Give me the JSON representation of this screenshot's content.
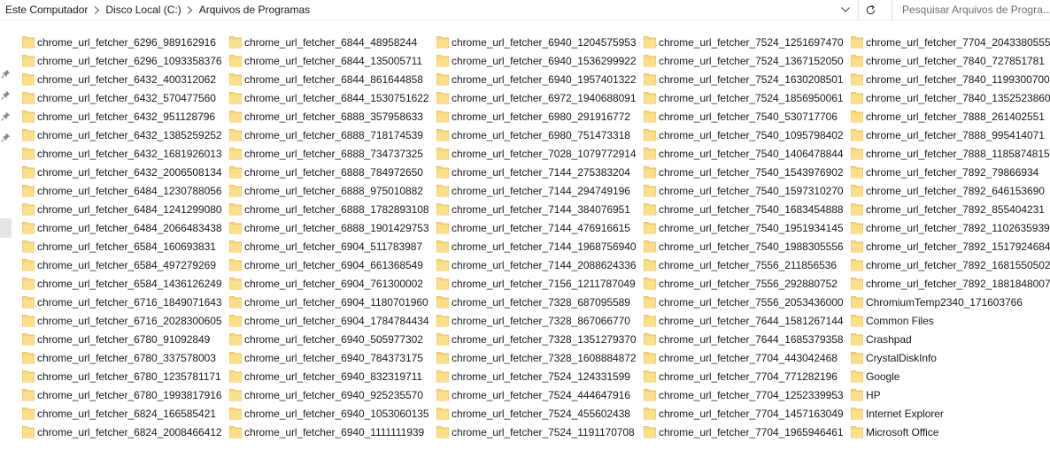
{
  "breadcrumb": {
    "items": [
      "Este Computador",
      "Disco Local (C:)",
      "Arquivos de Programas"
    ]
  },
  "search": {
    "placeholder": "Pesquisar Arquivos de Progra..."
  },
  "colors": {
    "folder_fill": "#f8d775",
    "folder_edge": "#e3b444",
    "hover": "#e5f3ff"
  },
  "icons": {
    "separator": "chevron-right-icon",
    "dropdown": "chevron-down-icon",
    "refresh": "refresh-icon",
    "pin": "pin-icon",
    "folder": "folder-icon"
  },
  "folders": {
    "columns": [
      [
        "chrome_url_fetcher_6296_989162916",
        "chrome_url_fetcher_6296_1093358376",
        "chrome_url_fetcher_6432_400312062",
        "chrome_url_fetcher_6432_570477560",
        "chrome_url_fetcher_6432_951128796",
        "chrome_url_fetcher_6432_1385259252",
        "chrome_url_fetcher_6432_1681926013",
        "chrome_url_fetcher_6432_2006508134",
        "chrome_url_fetcher_6484_1230788056",
        "chrome_url_fetcher_6484_1241299080",
        "chrome_url_fetcher_6484_2066483438",
        "chrome_url_fetcher_6584_160693831",
        "chrome_url_fetcher_6584_497279269",
        "chrome_url_fetcher_6584_1436126249",
        "chrome_url_fetcher_6716_1849071643",
        "chrome_url_fetcher_6716_2028300605",
        "chrome_url_fetcher_6780_91092849",
        "chrome_url_fetcher_6780_337578003",
        "chrome_url_fetcher_6780_1235781171",
        "chrome_url_fetcher_6780_1993817916",
        "chrome_url_fetcher_6824_166585421",
        "chrome_url_fetcher_6824_2008466412"
      ],
      [
        "chrome_url_fetcher_6844_48958244",
        "chrome_url_fetcher_6844_135005711",
        "chrome_url_fetcher_6844_861644858",
        "chrome_url_fetcher_6844_1530751622",
        "chrome_url_fetcher_6888_357958633",
        "chrome_url_fetcher_6888_718174539",
        "chrome_url_fetcher_6888_734737325",
        "chrome_url_fetcher_6888_784972650",
        "chrome_url_fetcher_6888_975010882",
        "chrome_url_fetcher_6888_1782893108",
        "chrome_url_fetcher_6888_1901429753",
        "chrome_url_fetcher_6904_511783987",
        "chrome_url_fetcher_6904_661368549",
        "chrome_url_fetcher_6904_761300002",
        "chrome_url_fetcher_6904_1180701960",
        "chrome_url_fetcher_6904_1784784434",
        "chrome_url_fetcher_6940_505977302",
        "chrome_url_fetcher_6940_784373175",
        "chrome_url_fetcher_6940_832319711",
        "chrome_url_fetcher_6940_925235570",
        "chrome_url_fetcher_6940_1053060135",
        "chrome_url_fetcher_6940_1111111939"
      ],
      [
        "chrome_url_fetcher_6940_1204575953",
        "chrome_url_fetcher_6940_1536299922",
        "chrome_url_fetcher_6940_1957401322",
        "chrome_url_fetcher_6972_1940688091",
        "chrome_url_fetcher_6980_291916772",
        "chrome_url_fetcher_6980_751473318",
        "chrome_url_fetcher_7028_1079772914",
        "chrome_url_fetcher_7144_275383204",
        "chrome_url_fetcher_7144_294749196",
        "chrome_url_fetcher_7144_384076951",
        "chrome_url_fetcher_7144_476916615",
        "chrome_url_fetcher_7144_1968756940",
        "chrome_url_fetcher_7144_2088624336",
        "chrome_url_fetcher_7156_1211787049",
        "chrome_url_fetcher_7328_687095589",
        "chrome_url_fetcher_7328_867066770",
        "chrome_url_fetcher_7328_1351279370",
        "chrome_url_fetcher_7328_1608884872",
        "chrome_url_fetcher_7524_124331599",
        "chrome_url_fetcher_7524_444647916",
        "chrome_url_fetcher_7524_455602438",
        "chrome_url_fetcher_7524_1191170708"
      ],
      [
        "chrome_url_fetcher_7524_1251697470",
        "chrome_url_fetcher_7524_1367152050",
        "chrome_url_fetcher_7524_1630208501",
        "chrome_url_fetcher_7524_1856950061",
        "chrome_url_fetcher_7540_530717706",
        "chrome_url_fetcher_7540_1095798402",
        "chrome_url_fetcher_7540_1406478844",
        "chrome_url_fetcher_7540_1543976902",
        "chrome_url_fetcher_7540_1597310270",
        "chrome_url_fetcher_7540_1683454888",
        "chrome_url_fetcher_7540_1951934145",
        "chrome_url_fetcher_7540_1988305556",
        "chrome_url_fetcher_7556_211856536",
        "chrome_url_fetcher_7556_292880752",
        "chrome_url_fetcher_7556_2053436000",
        "chrome_url_fetcher_7644_1581267144",
        "chrome_url_fetcher_7644_1685379358",
        "chrome_url_fetcher_7704_443042468",
        "chrome_url_fetcher_7704_771282196",
        "chrome_url_fetcher_7704_1252339953",
        "chrome_url_fetcher_7704_1457163049",
        "chrome_url_fetcher_7704_1965946461"
      ],
      [
        "chrome_url_fetcher_7704_2043380555",
        "chrome_url_fetcher_7840_727851781",
        "chrome_url_fetcher_7840_1199300700",
        "chrome_url_fetcher_7840_1352523860",
        "chrome_url_fetcher_7888_261402551",
        "chrome_url_fetcher_7888_995414071",
        "chrome_url_fetcher_7888_1185874815",
        "chrome_url_fetcher_7892_79866934",
        "chrome_url_fetcher_7892_646153690",
        "chrome_url_fetcher_7892_855404231",
        "chrome_url_fetcher_7892_1102635939",
        "chrome_url_fetcher_7892_1517924684",
        "chrome_url_fetcher_7892_1681550502",
        "chrome_url_fetcher_7892_1881848007",
        "ChromiumTemp2340_171603766",
        "Common Files",
        "Crashpad",
        "CrystalDiskInfo",
        "Google",
        "HP",
        "Internet Explorer",
        "Microsoft Office"
      ]
    ]
  }
}
